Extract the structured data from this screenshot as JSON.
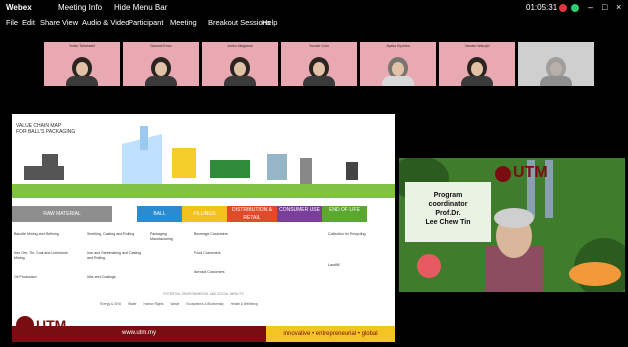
{
  "app": {
    "name": "Webex",
    "meeting_info": "Meeting Info",
    "hide_menu": "Hide Menu Bar",
    "timer": "01:05:31",
    "status_colors": [
      "#e0343f",
      "#2ecc71"
    ]
  },
  "menu": [
    "File",
    "Edit",
    "Share",
    "View",
    "Audio & Video",
    "Participant",
    "Meeting",
    "Breakout Sessions",
    "Help"
  ],
  "participants": [
    {
      "name": "Yoriko Takahashi"
    },
    {
      "name": "Nanami Endo"
    },
    {
      "name": "Junko Akagiwari"
    },
    {
      "name": "Yusuke Goto"
    },
    {
      "name": "Ayaka Kiyohira"
    },
    {
      "name": "Yamato Wakojiri"
    },
    {
      "name": ""
    }
  ],
  "slide": {
    "title_line1": "VALUE CHAIN MAP",
    "title_line2": "FOR BALL'S PACKAGING",
    "stages": [
      {
        "label": "RAW MATERIAL",
        "color": "#8e8e8e"
      },
      {
        "label": "BALL",
        "color": "#2a8bd1"
      },
      {
        "label": "FILLINGS",
        "color": "#f1c21b"
      },
      {
        "label": "DISTRIBUTION & RETAIL",
        "color": "#e04b2c"
      },
      {
        "label": "CONSUMER USE",
        "color": "#7a3e9b"
      },
      {
        "label": "END OF LIFE",
        "color": "#5aa832"
      }
    ],
    "col_texts": [
      [
        "Bauxite Mining and Refining",
        "Iron Ore, Tin, Coal and Limestone Mining",
        "Oil Production"
      ],
      [
        "Smelting, Casting and Rolling",
        "Iron and Steelmaking and Casting and Rolling",
        "Inks and Coatings"
      ],
      [
        "Packaging Manufacturing"
      ],
      [
        "Beverage Customers",
        "Food Customers",
        "Aerosol Customers"
      ],
      [],
      [
        "Collection for Recycling",
        "Landfill"
      ]
    ],
    "legend_title": "POTENTIAL ENVIRONMENTAL AND SOCIAL IMPACTS",
    "legend_items": [
      "Energy & GHG",
      "Water",
      "Human Rights",
      "Waste",
      "Ecosystems & Biodiversity",
      "Health & Wellbeing"
    ],
    "logo_text": "UTM",
    "url": "www.utm.my",
    "tagline": "innovative • entrepreneurial • global"
  },
  "video": {
    "logo_text": "UTM",
    "coordinator_line1": "Program",
    "coordinator_line2": "coordinator",
    "coordinator_line3": "Prof.Dr.",
    "coordinator_line4": "Lee Chew Tin"
  }
}
